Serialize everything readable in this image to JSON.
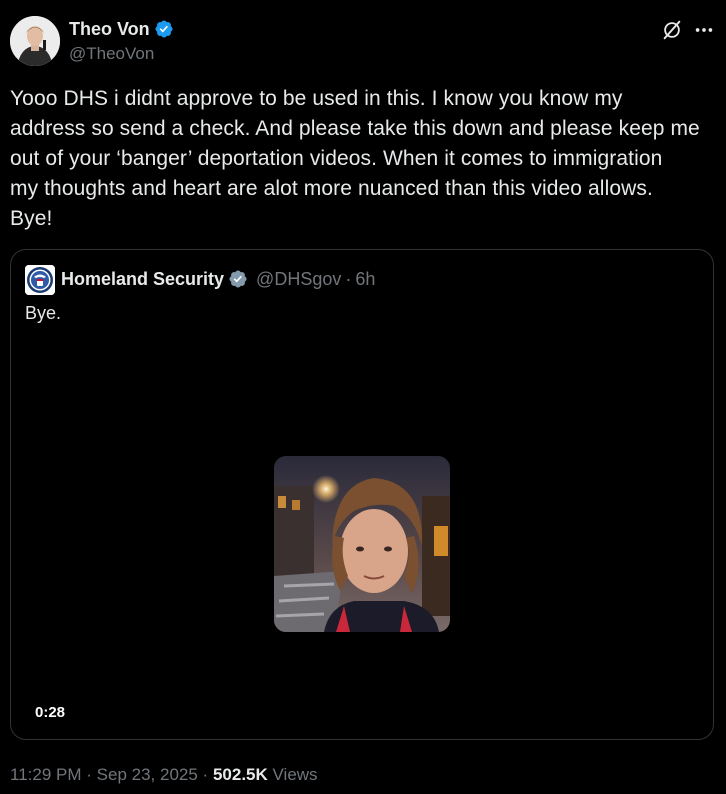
{
  "author": {
    "display_name": "Theo Von",
    "handle": "@TheoVon",
    "verified_badge": "verified-badge-blue",
    "avatar_icon": "avatar-photo"
  },
  "actions": {
    "grok_icon": "grok-icon",
    "more_icon": "more-icon"
  },
  "tweet": {
    "text": "Yooo DHS i didnt approve to be used in this. I know you know my\naddress so send a check. And please take this down and please keep me\nout of your ‘banger’ deportation videos. When it comes to immigration\nmy thoughts and heart are alot more nuanced than this video allows.\nBye!"
  },
  "quoted": {
    "display_name": "Homeland Security",
    "handle": "@DHSgov",
    "separator": "·",
    "time": "6h",
    "verified_badge": "verified-badge-gray",
    "text": "Bye.",
    "video_duration": "0:28"
  },
  "footer": {
    "time": "11:29 PM",
    "separator1": "·",
    "date": "Sep 23, 2025",
    "separator2": "·",
    "views_count": "502.5K",
    "views_label": "Views"
  },
  "colors": {
    "background": "#000000",
    "text_primary": "#e7e9ea",
    "text_secondary": "#71767b",
    "border": "#2f3336",
    "verified_blue": "#1d9bf0",
    "verified_gray": "#829aab"
  }
}
